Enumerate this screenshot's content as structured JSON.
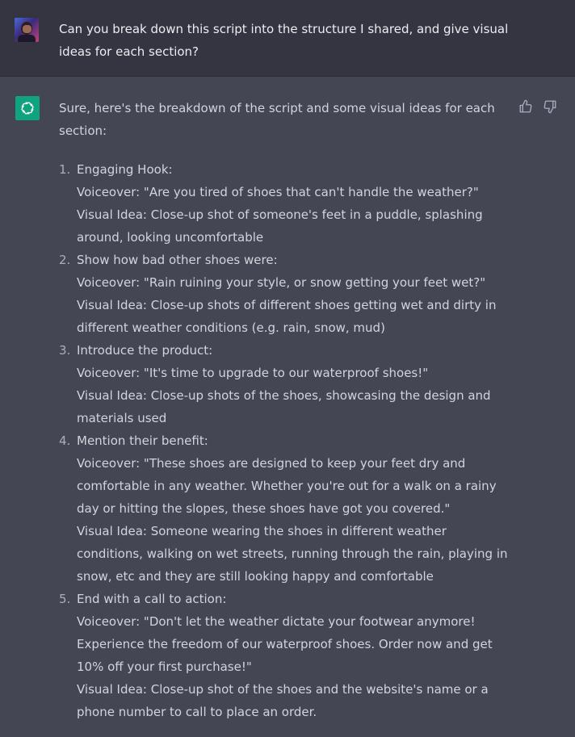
{
  "user_message": {
    "text": "Can you break down this script into the structure I shared, and give visual ideas for each section?"
  },
  "assistant_message": {
    "intro": "Sure, here's the breakdown of the script and some visual ideas for each section:",
    "sections": [
      {
        "number": "1.",
        "heading": "Engaging Hook:",
        "voiceover": "Voiceover: \"Are you tired of shoes that can't handle the weather?\"",
        "visual": "Visual Idea: Close-up shot of someone's feet in a puddle, splashing around, looking uncomfortable"
      },
      {
        "number": "2.",
        "heading": "Show how bad other shoes were:",
        "voiceover": "Voiceover: \"Rain ruining your style, or snow getting your feet wet?\"",
        "visual": "Visual Idea: Close-up shots of different shoes getting wet and dirty in different weather conditions (e.g. rain, snow, mud)"
      },
      {
        "number": "3.",
        "heading": "Introduce the product:",
        "voiceover": "Voiceover: \"It's time to upgrade to our waterproof shoes!\"",
        "visual": "Visual Idea: Close-up shots of the shoes, showcasing the design and materials used"
      },
      {
        "number": "4.",
        "heading": "Mention their benefit:",
        "voiceover": "Voiceover: \"These shoes are designed to keep your feet dry and comfortable in any weather. Whether you're out for a walk on a rainy day or hitting the slopes, these shoes have got you covered.\"",
        "visual": "Visual Idea: Someone wearing the shoes in different weather conditions, walking on wet streets, running through the rain, playing in snow, etc and they are still looking happy and comfortable"
      },
      {
        "number": "5.",
        "heading": "End with a call to action:",
        "voiceover": "Voiceover: \"Don't let the weather dictate your footwear anymore! Experience the freedom of our waterproof shoes. Order now and get 10% off your first purchase!\"",
        "visual": "Visual Idea: Close-up shot of the shoes and the website's name or a phone number to call to place an order."
      }
    ]
  },
  "icons": {
    "user_avatar": "user-avatar",
    "assistant_avatar": "openai-logo-icon",
    "thumbs_up": "thumbs-up-icon",
    "thumbs_down": "thumbs-down-icon"
  },
  "colors": {
    "user_row_bg": "#343541",
    "assistant_row_bg": "#444654",
    "assistant_avatar_bg": "#10a37f",
    "text": "#d1d5db"
  }
}
